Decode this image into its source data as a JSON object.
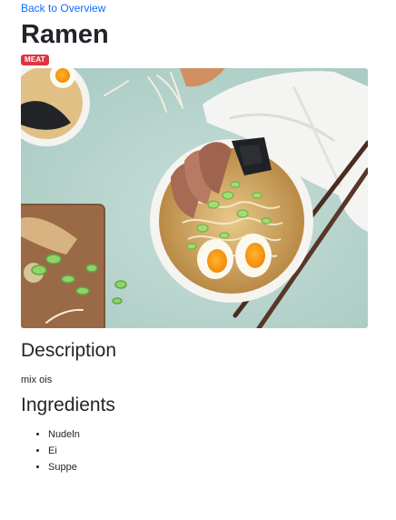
{
  "nav": {
    "back_label": "Back to Overview"
  },
  "recipe": {
    "title": "Ramen",
    "category_badge": "MEAT",
    "badge_color": "#dc3545",
    "image_alt": "Bowl of ramen with egg, sliced pork, noodles, spring onions and nori, chopsticks on the side"
  },
  "description": {
    "heading": "Description",
    "text": "mix ois"
  },
  "ingredients": {
    "heading": "Ingredients",
    "items": [
      "Nudeln",
      "Ei",
      "Suppe"
    ]
  },
  "colors": {
    "link": "#0d6efd",
    "text": "#212529",
    "tabletop": "#b9d6cf"
  }
}
